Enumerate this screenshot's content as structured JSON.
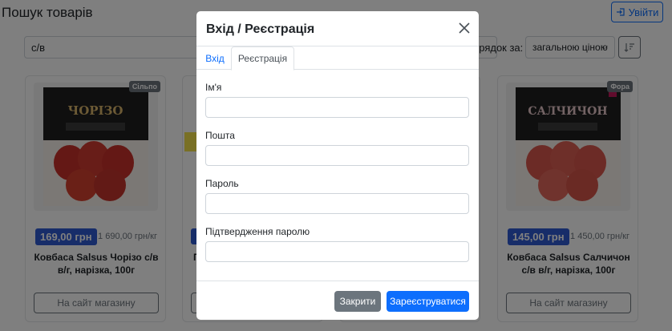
{
  "page": {
    "title": "Пошук товарів",
    "login_label": "Увійти",
    "search_value": "с/в",
    "sort_label": "орядок за:",
    "sort_value": "загальною ціною"
  },
  "products": [
    {
      "store": "Сільпо",
      "price": "169,00 грн",
      "unit_price": "1 690,00 грн/кг",
      "name": "Ковбаса Salsus Чорізо с/в в/г, нарізка, 100г",
      "pack_text": "ЧОРІЗО",
      "button": "На сайт магазину"
    },
    {
      "store": "",
      "price": "",
      "unit_price": "",
      "name": "П",
      "pack_text": "",
      "button": "Н"
    },
    {
      "store": "Фора",
      "price": "145,00 грн",
      "unit_price": "1 450,00 грн/кг",
      "name": "Ковбаса Salsus Салчичон с/в в/г, нарізка, 100г",
      "pack_text": "САЛЧИЧОН",
      "button": "На сайт магазину"
    }
  ],
  "modal": {
    "title": "Вхід / Реєстрація",
    "tab_login": "Вхід",
    "tab_register": "Реєстрація",
    "fields": [
      {
        "label": "Ім'я",
        "value": ""
      },
      {
        "label": "Пошта",
        "value": ""
      },
      {
        "label": "Пароль",
        "value": ""
      },
      {
        "label": "Підтвердження паролю",
        "value": ""
      }
    ],
    "close_button": "Закрити",
    "register_button": "Зареєструватися"
  },
  "colors": {
    "primary": "#0d6efd",
    "secondary": "#6c757d",
    "price_badge": "#2f5bd3"
  }
}
